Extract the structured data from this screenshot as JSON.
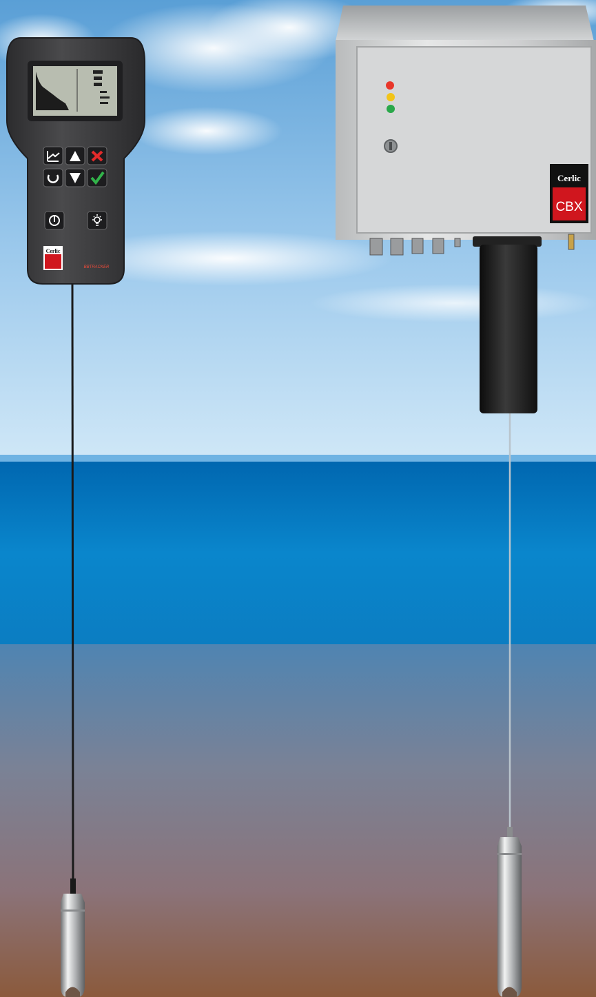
{
  "scene": {
    "colors": {
      "sky_top": "#5a9fd6",
      "sky_bottom": "#cfe7f7",
      "water_surface": "#6fb3e3",
      "water_top": "#0067b0",
      "water_mid": "#0a86cc",
      "sediment_top": "#5b86a6",
      "sediment_mid": "#857f8e",
      "sediment_bottom": "#8b5a3c",
      "handheld_body": "#3d3d3f",
      "cabinet_steel": "#d8d9d9",
      "cerlic_red": "#d0161e"
    }
  },
  "handheld": {
    "brand": "Cerlic",
    "product_name": "BBTRACKER",
    "keys": {
      "graph_icon": "graph-icon",
      "up_icon": "arrow-up-icon",
      "cancel_icon": "cancel-icon",
      "refresh_icon": "refresh-icon",
      "down_icon": "arrow-down-icon",
      "ok_icon": "check-icon",
      "power_icon": "power-icon",
      "light_icon": "light-icon"
    },
    "status_leds": []
  },
  "cabinet": {
    "brand": "Cerlic",
    "model": "CBX",
    "leds": [
      "#e8362a",
      "#f2c418",
      "#2aa84a"
    ]
  }
}
